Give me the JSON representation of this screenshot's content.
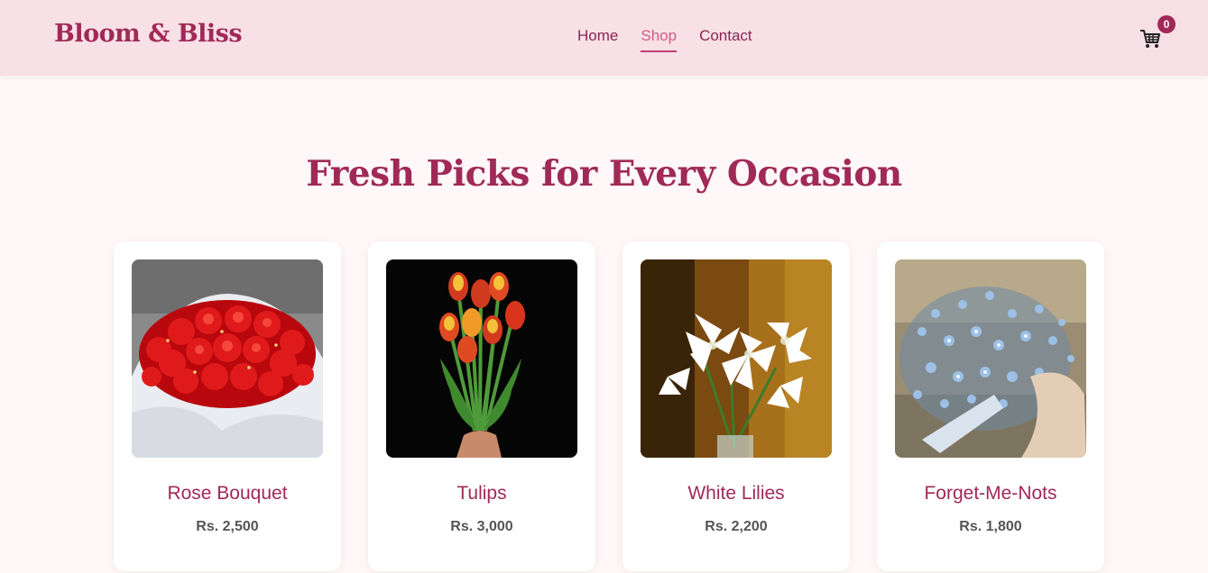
{
  "header": {
    "logo": "Bloom & Bliss",
    "nav": [
      {
        "label": "Home"
      },
      {
        "label": "Shop"
      },
      {
        "label": "Contact"
      }
    ],
    "cart_count": "0",
    "cart_icon": "shopping-cart-icon"
  },
  "main": {
    "title": "Fresh Picks for Every Occasion",
    "products": [
      {
        "name": "Rose Bouquet",
        "price": "Rs. 2,500"
      },
      {
        "name": "Tulips",
        "price": "Rs. 3,000"
      },
      {
        "name": "White Lilies",
        "price": "Rs. 2,200"
      },
      {
        "name": "Forget-Me-Nots",
        "price": "Rs. 1,800"
      }
    ]
  },
  "colors": {
    "brand": "#a02a57",
    "header_bg": "#f8e0e7",
    "page_bg": "#fff7f8",
    "active_nav": "#d45a86"
  }
}
